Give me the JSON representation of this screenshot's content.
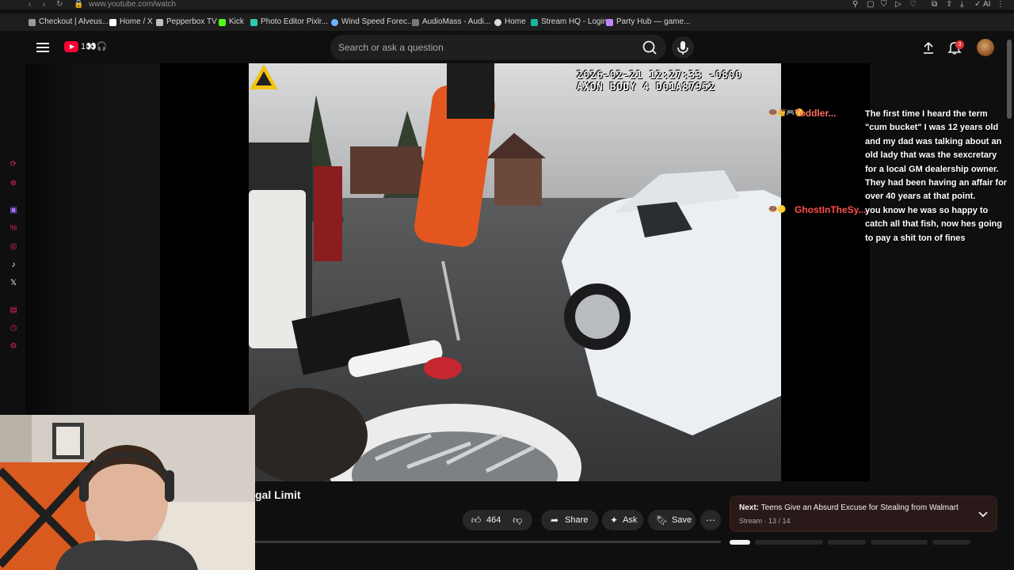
{
  "browser": {
    "url": "www.youtube.com/watch",
    "bookmarks": [
      {
        "label": "Checkout | Alveus...",
        "color": "#9b9b9b"
      },
      {
        "label": "Home / X",
        "color": "#ffffff"
      },
      {
        "label": "Pepperbox TV",
        "color": "#c0c0c0"
      },
      {
        "label": "Kick",
        "color": "#53fc18"
      },
      {
        "label": "Photo Editor Pixlr...",
        "color": "#2ec9b0"
      },
      {
        "label": "Wind Speed Forec...",
        "color": "#6cb6ff"
      },
      {
        "label": "AudioMass - Audi...",
        "color": "#777777"
      },
      {
        "label": "Home",
        "color": "#dddddd"
      },
      {
        "label": "Stream HQ - Login",
        "color": "#1db39b"
      },
      {
        "label": "Party Hub — game...",
        "color": "#c084fc"
      }
    ],
    "extensions_label": "AI"
  },
  "header": {
    "search_placeholder": "Search or ask a question",
    "notification_count": "3"
  },
  "video": {
    "timestamp_line": "2026-02-21 12:27:33 -0800",
    "device_line": "AXON BODY 4 D01A87952",
    "title": "gal Limit"
  },
  "chat": [
    {
      "user": "Toddler...",
      "user_color": "#ff6f5e",
      "message": "The first time I heard the term \"cum bucket\" I was 12 years old and my dad was talking about an old lady that was the sexcretary for a local GM dealership owner. They had been having an affair for over 40 years at that point."
    },
    {
      "user": "GhostInTheSy...",
      "user_color": "#ff4d4d",
      "message": "you know he was so happy to catch all that fish, now hes going to pay a shit ton of fines"
    }
  ],
  "actions": {
    "like_count": "464",
    "share_label": "Share",
    "ask_label": "Ask",
    "save_label": "Save"
  },
  "next": {
    "prefix": "Next:",
    "title": "Teens Give an Absurd Excuse for Stealing from Walmart",
    "subtitle": "Stream · 13 / 14"
  },
  "colors": {
    "background": "#0f0f0f",
    "brand_red": "#ff0033",
    "chat_user": "#ff6f5e",
    "sidebar_accent": "#e0245e"
  }
}
